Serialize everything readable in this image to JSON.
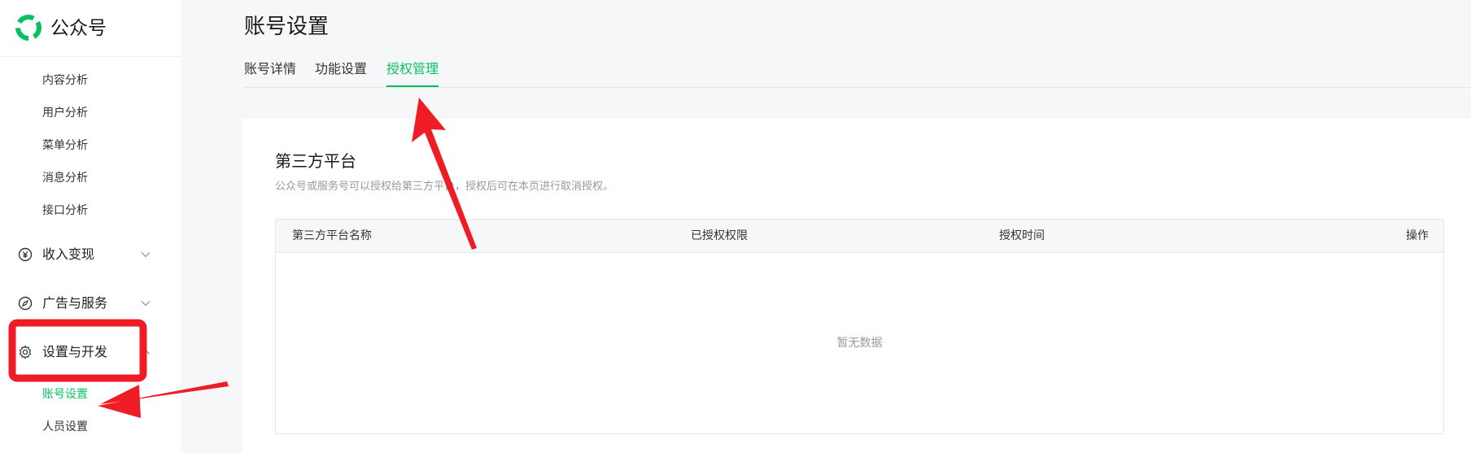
{
  "brand": {
    "name": "公众号",
    "logo_icon": "wechat-official-account-logo",
    "color": "#07c160"
  },
  "sidebar": {
    "analysis_items": [
      {
        "label": "内容分析"
      },
      {
        "label": "用户分析"
      },
      {
        "label": "菜单分析"
      },
      {
        "label": "消息分析"
      },
      {
        "label": "接口分析"
      }
    ],
    "groups": [
      {
        "label": "收入变现",
        "icon": "yuan-coin-icon",
        "expanded": false
      },
      {
        "label": "广告与服务",
        "icon": "compass-icon",
        "expanded": false
      },
      {
        "label": "设置与开发",
        "icon": "gear-icon",
        "expanded": true
      }
    ],
    "settings_items": [
      {
        "label": "账号设置",
        "active": true
      },
      {
        "label": "人员设置",
        "active": false
      }
    ]
  },
  "page": {
    "title": "账号设置",
    "tabs": [
      {
        "label": "账号详情",
        "active": false
      },
      {
        "label": "功能设置",
        "active": false
      },
      {
        "label": "授权管理",
        "active": true
      }
    ]
  },
  "section": {
    "title": "第三方平台",
    "description": "公众号或服务号可以授权给第三方平台，授权后可在本页进行取消授权。",
    "table": {
      "columns": [
        "第三方平台名称",
        "已授权权限",
        "授权时间",
        "操作"
      ],
      "rows": [],
      "empty_text": "暂无数据"
    }
  },
  "colors": {
    "accent": "#07c160",
    "annotation": "#ee1c25"
  }
}
